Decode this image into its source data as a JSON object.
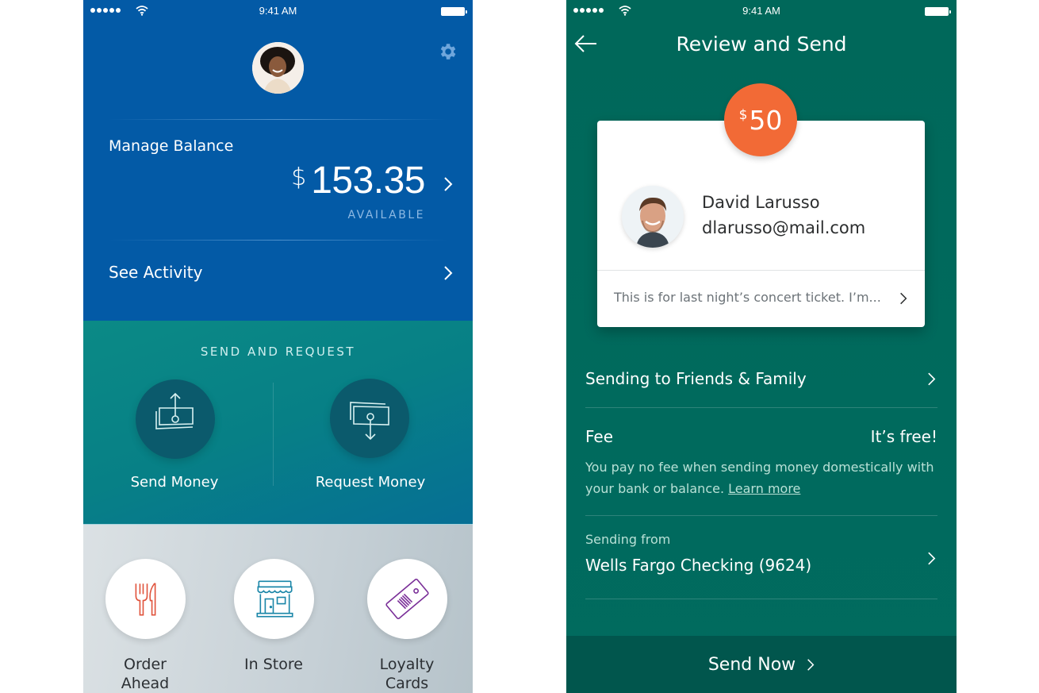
{
  "status_bar": {
    "time": "9:41 AM"
  },
  "home_screen": {
    "manage_balance": {
      "label": "Manage Balance",
      "currency_symbol": "$",
      "amount": "153.35",
      "caption": "AVAILABLE"
    },
    "see_activity_label": "See Activity",
    "send_request": {
      "title": "SEND AND REQUEST",
      "actions": [
        {
          "label": "Send Money",
          "icon": "send-money-icon"
        },
        {
          "label": "Request Money",
          "icon": "request-money-icon"
        }
      ]
    },
    "shortcuts": [
      {
        "label_line1": "Order",
        "label_line2": "Ahead",
        "icon": "fork-knife-icon",
        "color": "#e0533c"
      },
      {
        "label_line1": "In Store",
        "label_line2": "",
        "icon": "storefront-icon",
        "color": "#1a86a8"
      },
      {
        "label_line1": "Loyalty",
        "label_line2": "Cards",
        "icon": "loyalty-card-icon",
        "color": "#7a2f98"
      }
    ]
  },
  "review_screen": {
    "title": "Review and Send",
    "amount": {
      "currency_symbol": "$",
      "value": "50"
    },
    "recipient": {
      "name": "David Larusso",
      "email": "dlarusso@mail.com"
    },
    "note": "This is for last night’s concert ticket. I’m...",
    "payment_type": "Sending to Friends & Family",
    "fee": {
      "label": "Fee",
      "value": "It’s free!",
      "description": "You pay no fee when sending money domestically with your bank or balance.",
      "link": "Learn more"
    },
    "sending_from": {
      "label": "Sending from",
      "account": "Wells Fargo Checking (9624)"
    },
    "send_button": "Send Now"
  },
  "colors": {
    "home_blue": "#035aa6",
    "review_green": "#00685a",
    "send_bar": "#01564d",
    "amount_orange": "#f26a36"
  }
}
